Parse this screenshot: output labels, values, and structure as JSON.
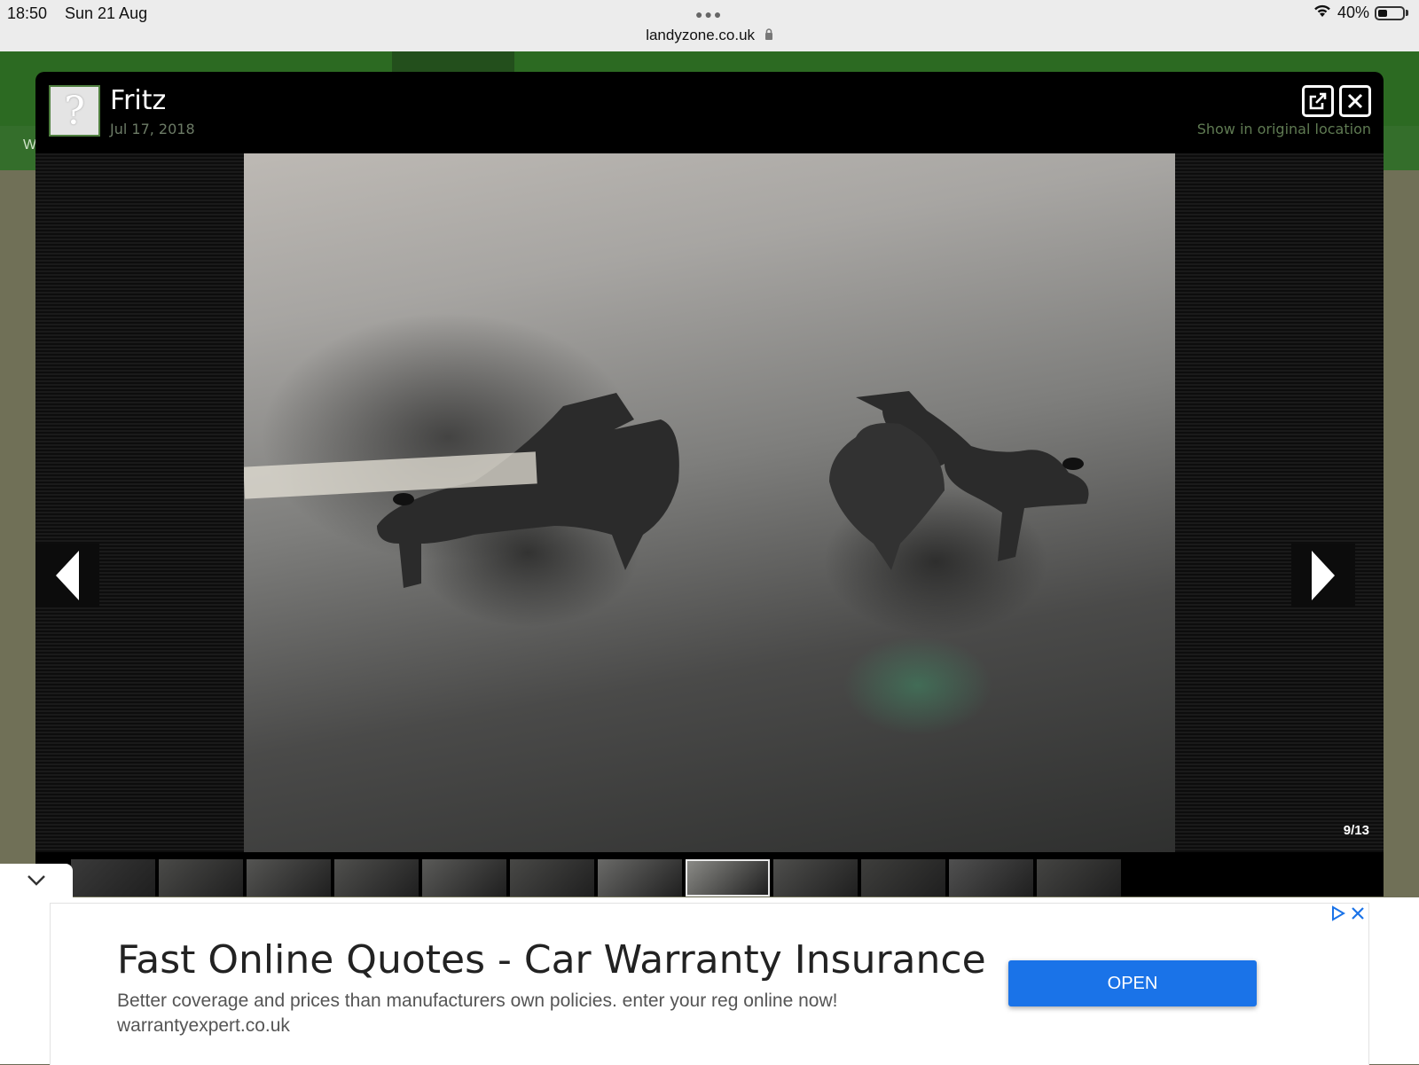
{
  "status_bar": {
    "time": "18:50",
    "date": "Sun 21 Aug",
    "url": "landyzone.co.uk",
    "battery": "40%",
    "battery_level": 0.4
  },
  "site": {
    "nav_partial": "W"
  },
  "lightbox": {
    "author": "Fritz",
    "date": "Jul 17, 2018",
    "show_original": "Show in original location",
    "counter": "9/13",
    "active_thumb": 7,
    "thumb_count": 12
  },
  "ad": {
    "title": "Fast Online Quotes - Car Warranty Insurance",
    "description": "Better coverage and prices than manufacturers own policies. enter your reg online now!",
    "domain": "warrantyexpert.co.uk",
    "button": "OPEN",
    "accent": "#1a73e8"
  },
  "colors": {
    "site_green": "#2c6a22",
    "lightbox_bg": "#000000"
  }
}
